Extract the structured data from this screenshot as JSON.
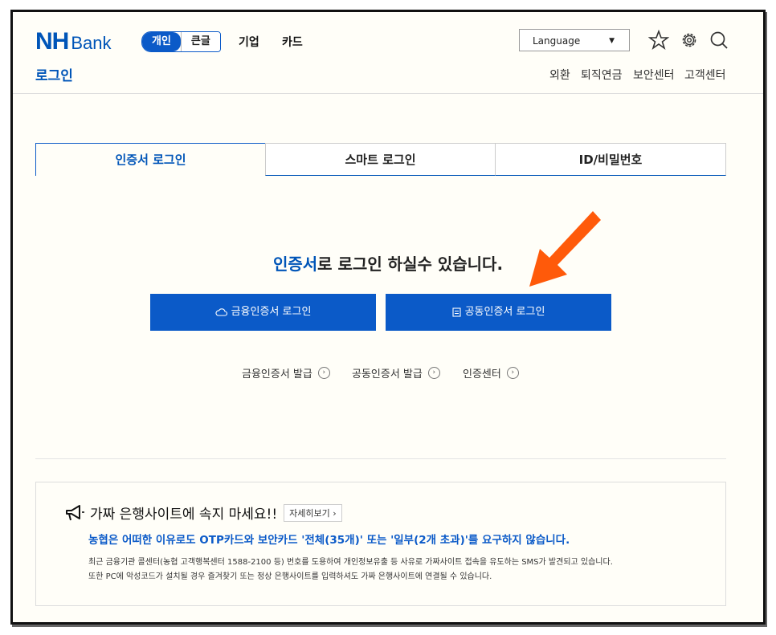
{
  "header": {
    "logo_nh": "NH",
    "logo_bank": "Bank",
    "segment": {
      "personal": "개인",
      "large_text": "큰글"
    },
    "nav": {
      "corporate": "기업",
      "card": "카드"
    },
    "language": "Language",
    "page_title": "로그인",
    "utility": [
      "외환",
      "퇴직연금",
      "보안센터",
      "고객센터"
    ],
    "icons": [
      "star-icon",
      "gear-icon",
      "search-icon"
    ]
  },
  "tabs": [
    "인증서 로그인",
    "스마트 로그인",
    "ID/비밀번호"
  ],
  "main": {
    "headline_highlight": "인증서",
    "headline_rest": "로 로그인 하실수 있습니다.",
    "btn_financial": "금융인증서 로그인",
    "btn_joint": "공동인증서 로그인",
    "links": [
      "금융인증서 발급",
      "공동인증서 발급",
      "인증센터"
    ]
  },
  "notice": {
    "title": "가짜 은행사이트에 속지 마세요!!",
    "more": "자세히보기",
    "warning": "농협은 어떠한 이유로도 OTP카드와 보안카드 '전체(35개)' 또는 '일부(2개 초과)'를 요구하지 않습니다.",
    "line1": "최근 금융기관 콜센터(농협 고객행복센터 1588-2100 등) 번호를 도용하여 개인정보유출 등 사유로 가짜사이트 접속을 유도하는 SMS가 발견되고 있습니다.",
    "line2": "또한 PC에 악성코드가 설치될 경우 즐겨찾기 또는 정상 은행사이트를 입력하셔도 가짜 은행사이트에 연결될 수 있습니다."
  },
  "colors": {
    "brand": "#0055b8",
    "button": "#0b5ac8",
    "annotation_arrow": "#ff5a0a"
  }
}
